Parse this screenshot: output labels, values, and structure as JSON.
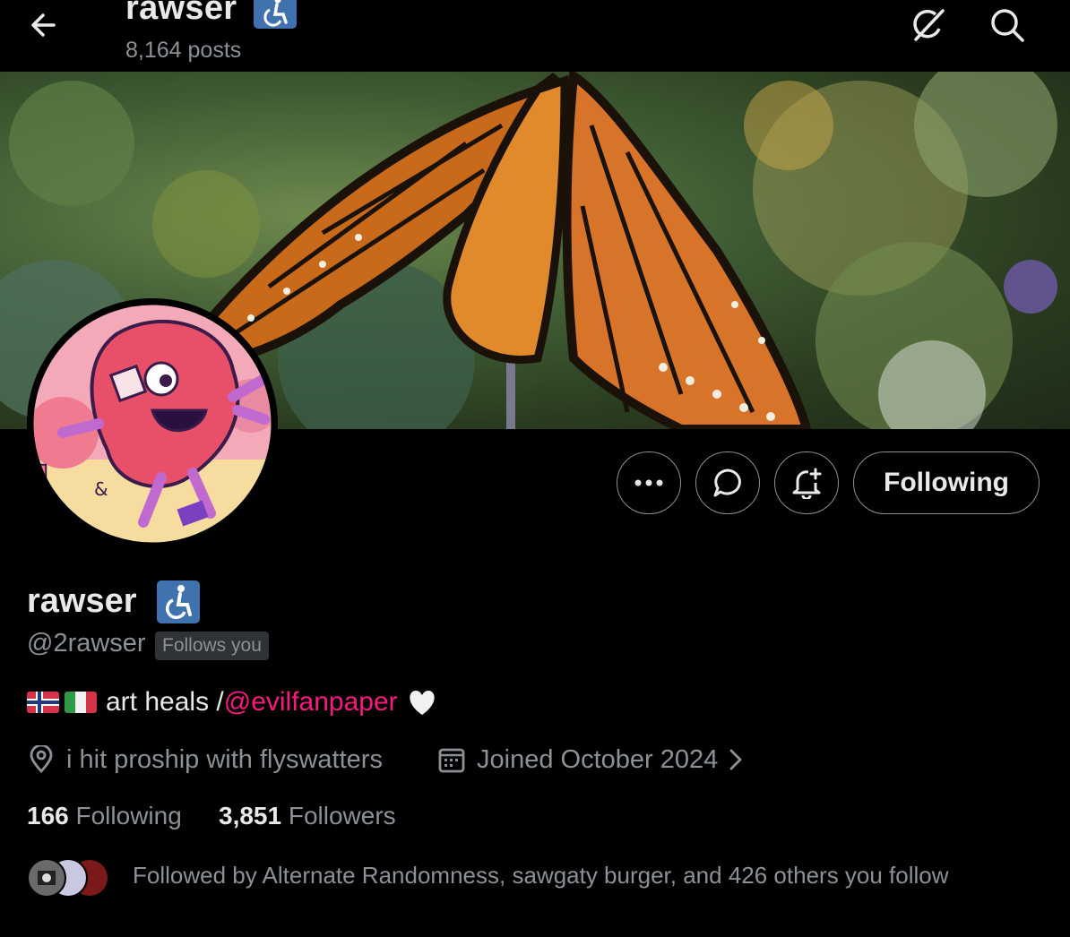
{
  "header": {
    "title": "rawser",
    "posts_count": "8,164 posts",
    "back_icon": "arrow-left-icon",
    "grok_icon": "grok-icon",
    "search_icon": "search-icon"
  },
  "profile": {
    "display_name": "rawser",
    "handle": "@2rawser",
    "follows_you": "Follows you",
    "badge_icon": "wheelchair-icon",
    "bio_text": "art heals /",
    "bio_mention": "@evilfanpaper",
    "bio_flags": [
      "norway-flag-icon",
      "italy-flag-icon"
    ],
    "bio_heart": "white-heart-icon",
    "location": "i hit proship with flyswatters",
    "joined": "Joined October 2024",
    "following_count": "166",
    "following_label": "Following",
    "followers_count": "3,851",
    "followers_label": "Followers",
    "followed_by": "Followed by Alternate Randomness, sawgaty burger, and 426 others you follow"
  },
  "actions": {
    "more_icon": "more-icon",
    "message_icon": "message-icon",
    "notify_icon": "bell-plus-icon",
    "following_button": "Following"
  },
  "colors": {
    "background": "#000000",
    "text_primary": "#e7e9ea",
    "text_secondary": "#8b9197",
    "mention": "#f91880",
    "badge_blue": "#3f72af"
  }
}
